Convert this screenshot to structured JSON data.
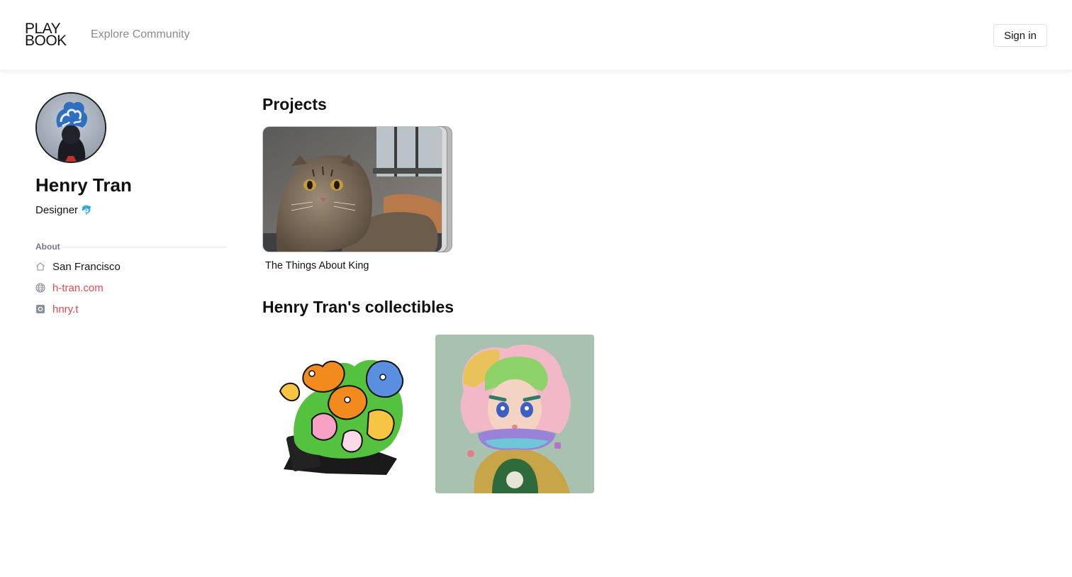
{
  "header": {
    "logo_line1": "PLAY",
    "logo_line2": "BOOK",
    "explore_label": "Explore Community",
    "signin_label": "Sign in"
  },
  "profile": {
    "name": "Henry Tran",
    "role": "Designer",
    "role_emoji": "🐬",
    "about_label": "About",
    "location": "San Francisco",
    "website": "h-tran.com",
    "instagram": "hnry.t"
  },
  "projects": {
    "title": "Projects",
    "items": [
      {
        "title": "The Things About King"
      }
    ]
  },
  "collectibles": {
    "title": "Henry Tran's collectibles"
  },
  "colors": {
    "link": "#e5484d",
    "muted": "#8a8a8a",
    "label": "#737885"
  }
}
